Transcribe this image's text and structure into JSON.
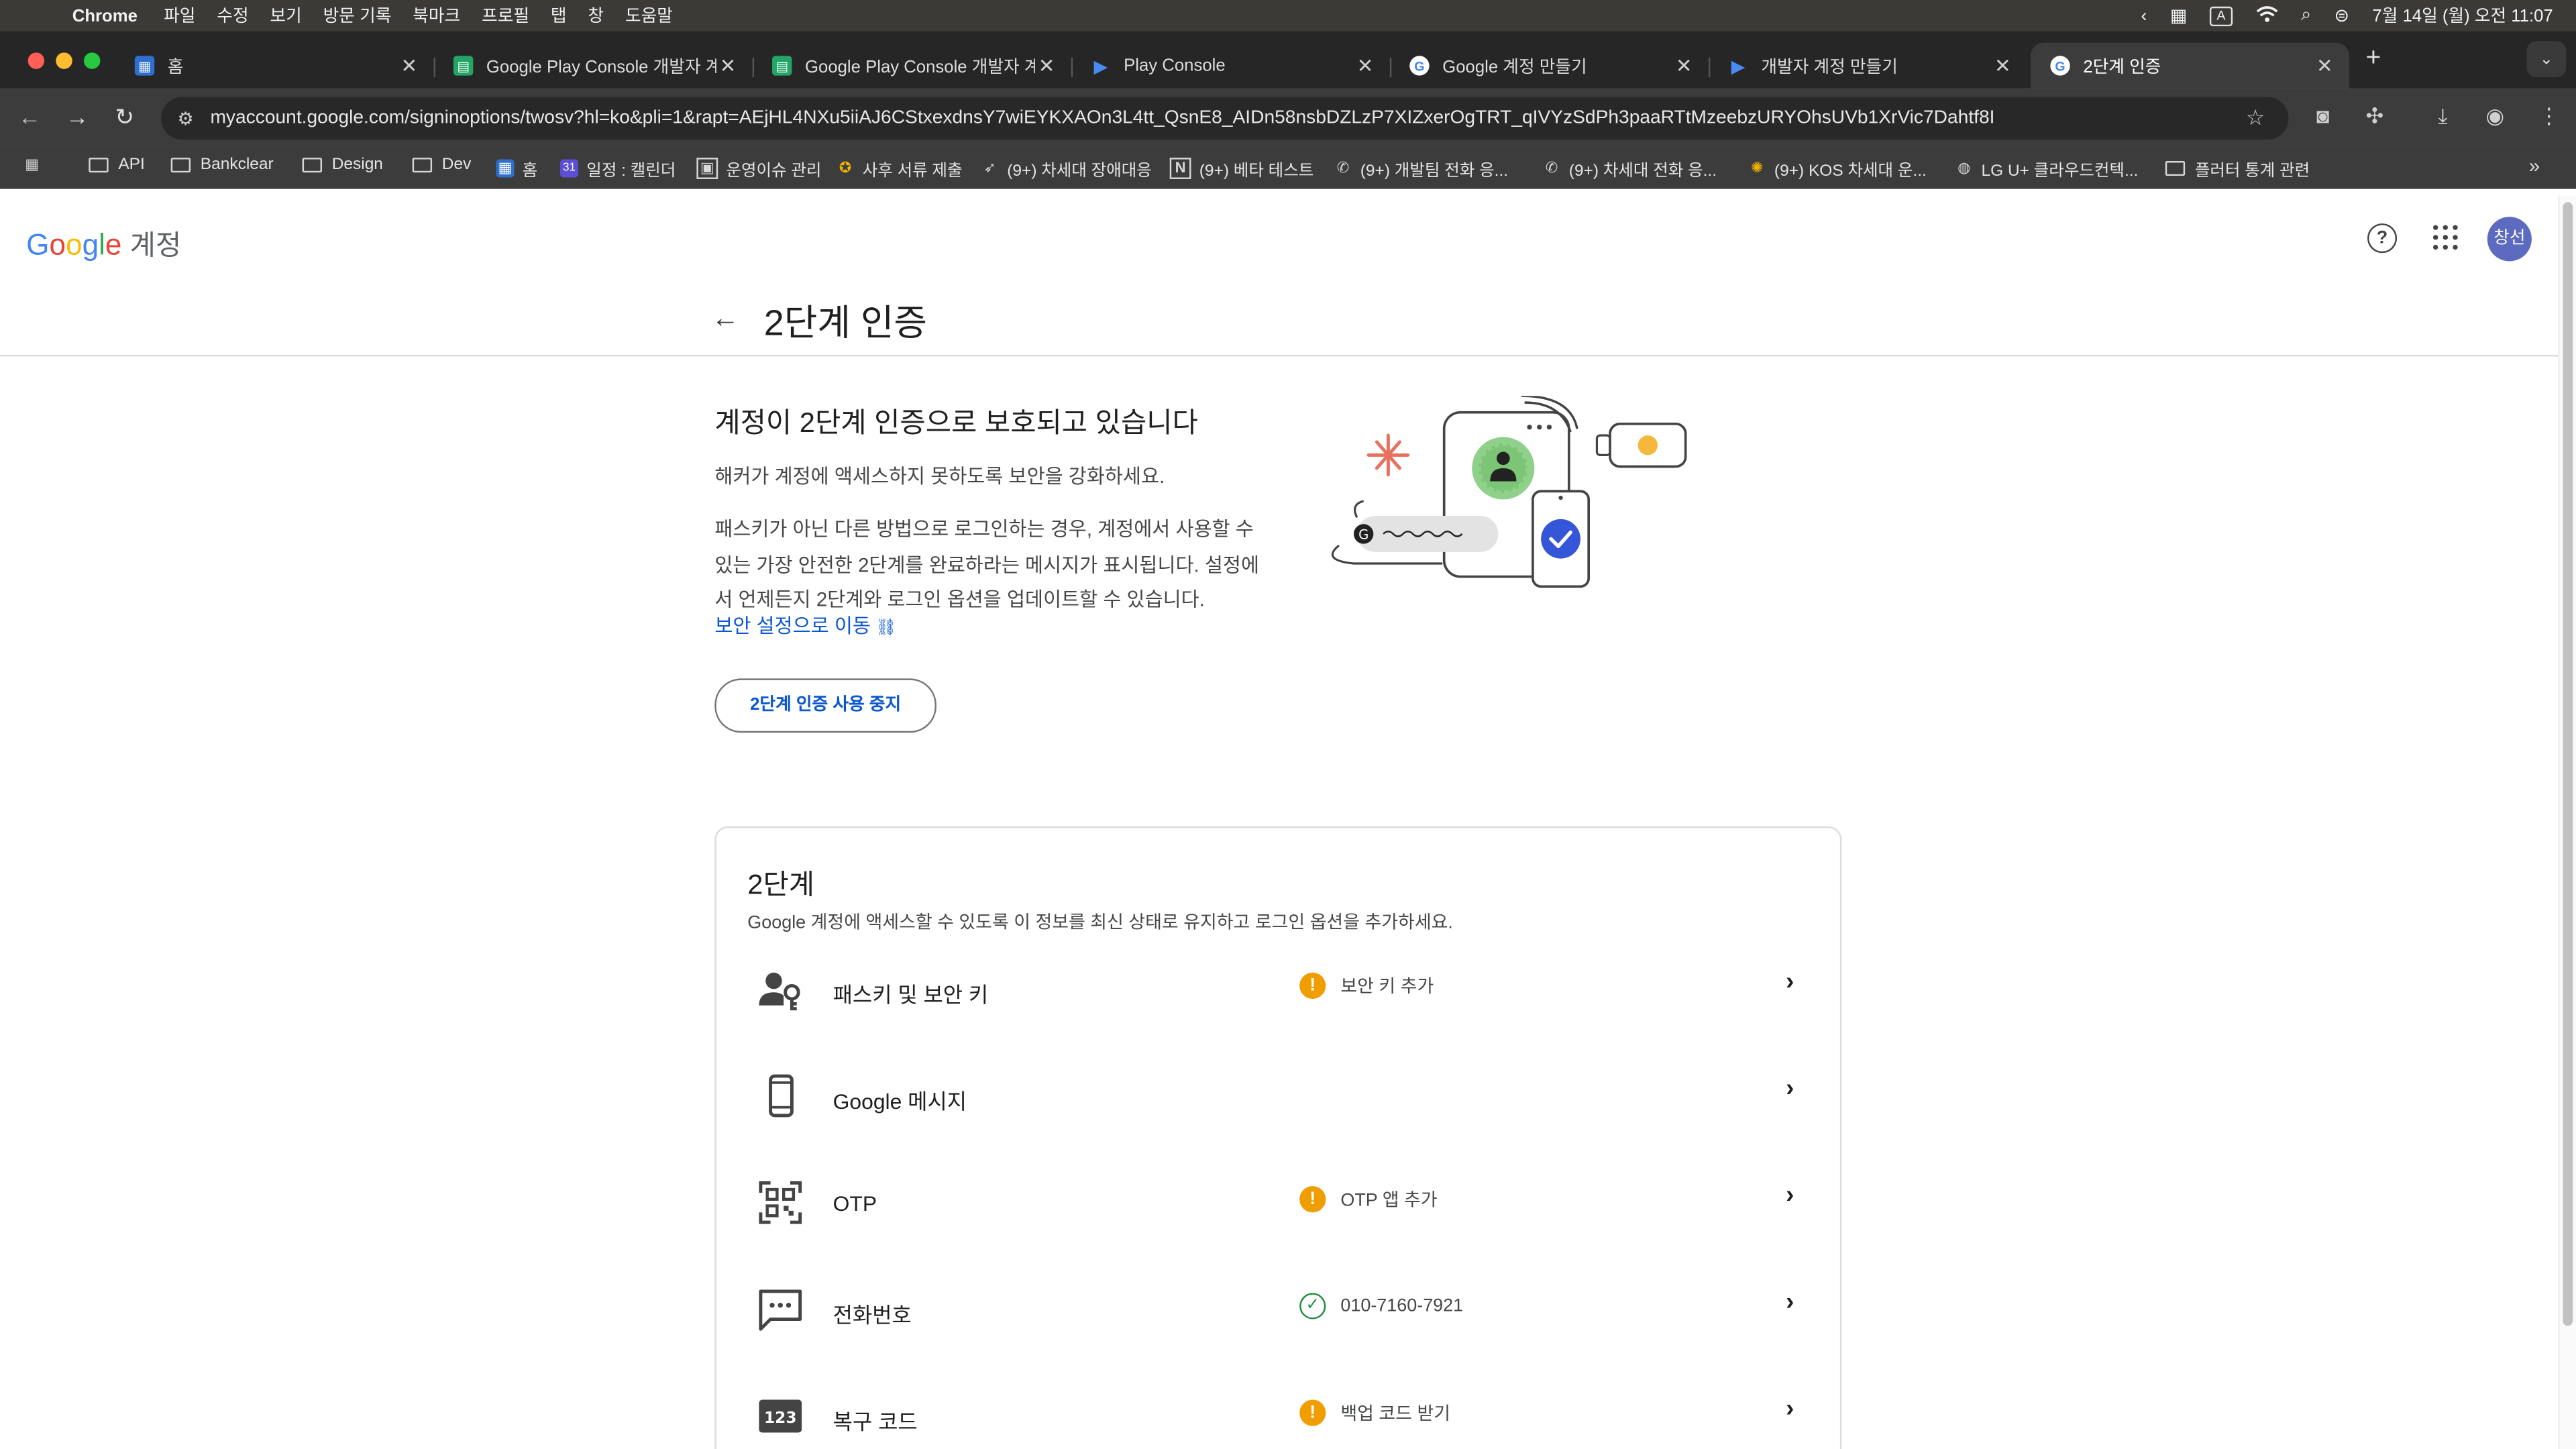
{
  "menubar": {
    "app": "Chrome",
    "menus": [
      "파일",
      "수정",
      "보기",
      "방문 기록",
      "북마크",
      "프로필",
      "탭",
      "창",
      "도움말"
    ],
    "clock": "7월 14일 (월) 오전 11:07",
    "input_indicator": "A"
  },
  "tabs": [
    {
      "label": "홈",
      "favicon": "confluence-icon",
      "color": "#2e6fcf"
    },
    {
      "label": "Google Play Console 개발자 계...",
      "favicon": "sheets-icon",
      "color": "#23a566"
    },
    {
      "label": "Google Play Console 개발자 계...",
      "favicon": "sheets-icon",
      "color": "#23a566"
    },
    {
      "label": "Play Console",
      "favicon": "play-console-icon",
      "color": "#4a8af4"
    },
    {
      "label": "Google 계정 만들기",
      "favicon": "google-icon",
      "color": "#ffffff"
    },
    {
      "label": "개발자 계정 만들기",
      "favicon": "play-console-icon",
      "color": "#4a8af4"
    },
    {
      "label": "2단계 인증",
      "favicon": "google-icon",
      "color": "#ffffff",
      "active": true
    }
  ],
  "toolbar": {
    "url": "myaccount.google.com/signinoptions/twosv?hl=ko&pli=1&rapt=AEjHL4NXu5iiAJ6CStxexdnsY7wiEYKXAOn3L4tt_QsnE8_AIDn58nsbDZLzP7XIZxerOgTRT_qIVYzSdPh3paaRTtMzeebzURYOhsUVb1XrVic7Dahtf8I"
  },
  "bookmarks": [
    {
      "label": "",
      "icon": "apps-grid-icon"
    },
    {
      "label": "API",
      "icon": "folder-icon"
    },
    {
      "label": "Bankclear",
      "icon": "folder-icon"
    },
    {
      "label": "Design",
      "icon": "folder-icon"
    },
    {
      "label": "Dev",
      "icon": "folder-icon"
    },
    {
      "label": "홈",
      "icon": "confluence-icon"
    },
    {
      "label": "일정 : 캘린더",
      "icon": "calendar-icon"
    },
    {
      "label": "운영이슈 관리",
      "icon": "board-icon"
    },
    {
      "label": "사후 서류 제출",
      "icon": "badge-icon"
    },
    {
      "label": "(9+) 차세대 장애대응",
      "icon": "bird-icon"
    },
    {
      "label": "(9+) 베타 테스트",
      "icon": "notion-icon"
    },
    {
      "label": "(9+) 개발팀 전화 응...",
      "icon": "phone-icon"
    },
    {
      "label": "(9+) 차세대 전화 응...",
      "icon": "phone-icon"
    },
    {
      "label": "(9+) KOS 차세대 운...",
      "icon": "sun-icon"
    },
    {
      "label": "LG U+ 클라우드컨텍...",
      "icon": "globe-icon"
    },
    {
      "label": "플러터 통계 관련",
      "icon": "folder-icon"
    }
  ],
  "header": {
    "logo": "Google",
    "logo_suffix": "계정",
    "avatar_text": "창선"
  },
  "main": {
    "title": "2단계 인증",
    "hero_title": "계정이 2단계 인증으로 보호되고 있습니다",
    "hero_sub": "해커가 계정에 액세스하지 못하도록 보안을 강화하세요.",
    "hero_body": "패스키가 아닌 다른 방법으로 로그인하는 경우, 계정에서 사용할 수 있는 가장 안전한 2단계를 완료하라는 메시지가 표시됩니다. 설정에서 언제든지 2단계와 로그인 옵션을 업데이트할 수 있습니다.",
    "security_link": "보안 설정으로 이동",
    "stop_button": "2단계 인증 사용 중지"
  },
  "card": {
    "title": "2단계",
    "description": "Google 계정에 액세스할 수 있도록 이 정보를 최신 상태로 유지하고 로그인 옵션을 추가하세요.",
    "rows": [
      {
        "label": "패스키 및 보안 키",
        "icon": "passkey-icon",
        "status": "보안 키 추가",
        "status_type": "warning"
      },
      {
        "label": "Google 메시지",
        "icon": "phone-device-icon",
        "status": "",
        "status_type": "none"
      },
      {
        "label": "OTP",
        "icon": "qr-code-icon",
        "status": "OTP 앱 추가",
        "status_type": "warning"
      },
      {
        "label": "전화번호",
        "icon": "sms-icon",
        "status": "010-7160-7921",
        "status_type": "ok"
      },
      {
        "label": "복구 코드",
        "icon": "backup-code-icon",
        "icon_text": "123",
        "status": "백업 코드 받기",
        "status_type": "warning"
      }
    ]
  },
  "colors": {
    "accent_link": "#0b57d0",
    "warning": "#f09d00",
    "ok": "#1e8e3e",
    "avatar_bg": "#5c6bc0"
  }
}
